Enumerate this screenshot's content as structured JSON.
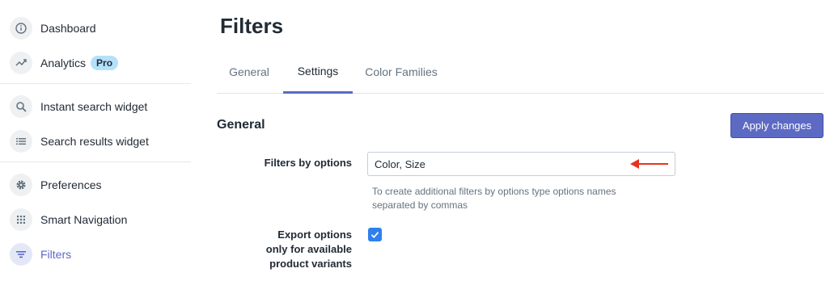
{
  "sidebar": {
    "items": [
      {
        "label": "Dashboard",
        "icon": "info-icon"
      },
      {
        "label": "Analytics",
        "icon": "trending-up-icon",
        "badge": "Pro"
      },
      {
        "label": "Instant search widget",
        "icon": "search-icon"
      },
      {
        "label": "Search results widget",
        "icon": "list-icon"
      },
      {
        "label": "Preferences",
        "icon": "gear-icon"
      },
      {
        "label": "Smart Navigation",
        "icon": "grid-icon"
      },
      {
        "label": "Filters",
        "icon": "filter-icon",
        "active": true
      }
    ]
  },
  "page": {
    "title": "Filters"
  },
  "tabs": [
    {
      "label": "General"
    },
    {
      "label": "Settings",
      "selected": true
    },
    {
      "label": "Color Families"
    }
  ],
  "section": {
    "title": "General",
    "apply_label": "Apply changes"
  },
  "filters_by_options": {
    "label": "Filters by options",
    "value": "Color, Size",
    "help": "To create additional filters by options type options names separated by commas"
  },
  "export_options": {
    "label_line1": "Export options",
    "label_line2": "only for available",
    "label_line3": "product variants",
    "checked": true
  },
  "colors": {
    "accent": "#5c6ac4",
    "checkbox": "#2f80ed",
    "arrow": "#e8321f"
  }
}
